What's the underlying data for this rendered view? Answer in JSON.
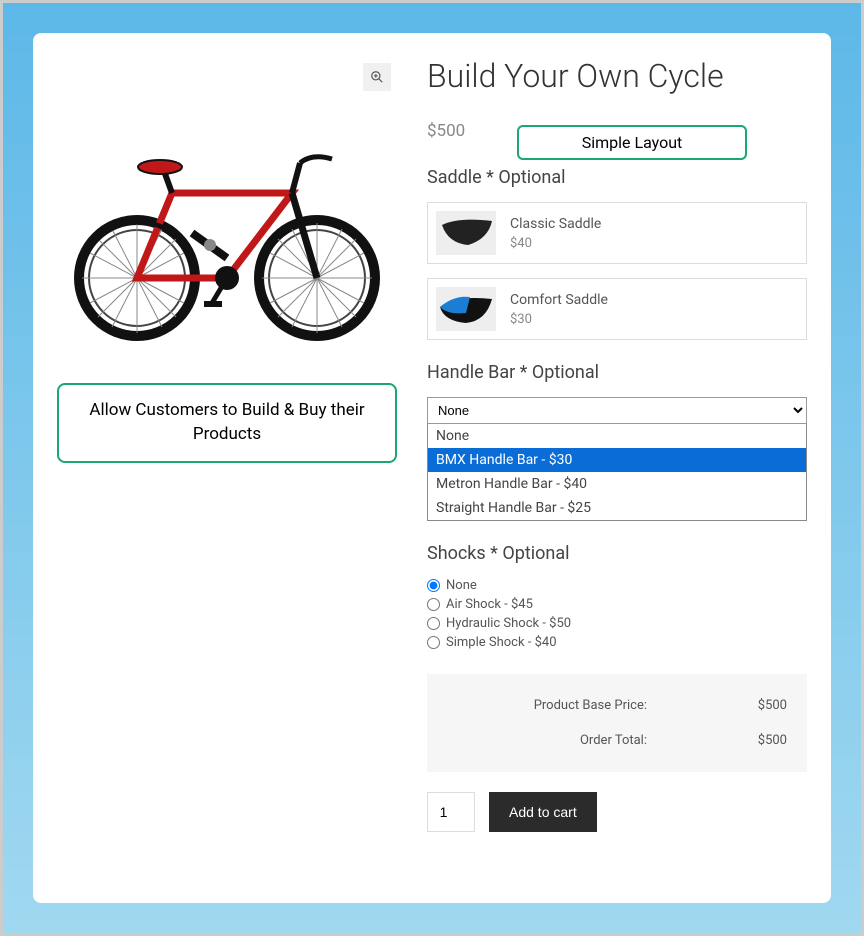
{
  "title": "Build Your Own Cycle",
  "price": "$500",
  "annotation_top": "Simple Layout",
  "annotation_left": "Allow Customers to Build & Buy their Products",
  "saddle": {
    "label": "Saddle * Optional",
    "options": [
      {
        "name": "Classic Saddle",
        "price": "$40"
      },
      {
        "name": "Comfort Saddle",
        "price": "$30"
      }
    ]
  },
  "handlebar": {
    "label": "Handle Bar * Optional",
    "selected": "None",
    "options": [
      "None",
      "BMX Handle Bar - $30",
      "Metron Handle Bar - $40",
      "Straight Handle Bar - $25"
    ],
    "highlighted_index": 1
  },
  "shocks": {
    "label": "Shocks * Optional",
    "options": [
      "None",
      "Air Shock - $45",
      "Hydraulic Shock - $50",
      "Simple Shock - $40"
    ],
    "selected_index": 0
  },
  "totals": {
    "base_label": "Product Base Price:",
    "base_value": "$500",
    "total_label": "Order Total:",
    "total_value": "$500"
  },
  "quantity": "1",
  "add_to_cart": "Add to cart"
}
